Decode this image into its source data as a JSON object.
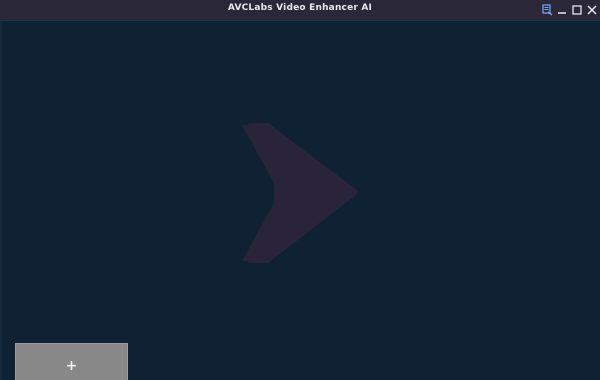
{
  "window": {
    "title": "AVCLabs Video Enhancer AI",
    "controls": [
      "menu-icon",
      "minimize-icon",
      "maximize-icon",
      "close-icon"
    ]
  },
  "main": {
    "placeholder_icon": "play-arrow-icon",
    "add_button": {
      "icon": "plus-icon",
      "label": "+"
    }
  },
  "colors": {
    "titlebar": "#2a2838",
    "background": "#0f2233",
    "play_arrow": "#292439",
    "add_button": "#888888"
  }
}
